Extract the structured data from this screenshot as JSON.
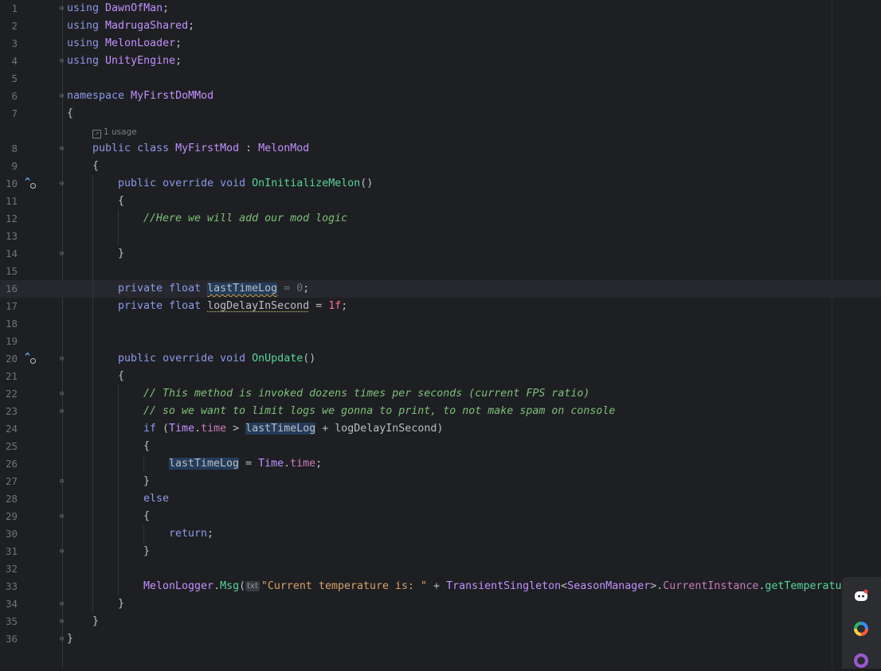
{
  "editor": {
    "line_numbers": [
      "1",
      "2",
      "3",
      "4",
      "5",
      "6",
      "7",
      "8",
      "9",
      "10",
      "11",
      "12",
      "13",
      "14",
      "15",
      "16",
      "17",
      "18",
      "19",
      "20",
      "21",
      "22",
      "23",
      "24",
      "25",
      "26",
      "27",
      "28",
      "29",
      "30",
      "31",
      "32",
      "33",
      "34",
      "35",
      "36"
    ],
    "usage_hint": "1 usage",
    "param_hint": "txt",
    "tokens": {
      "using": "using",
      "ns1": "DawnOfMan",
      "ns2": "MadrugaShared",
      "ns3": "MelonLoader",
      "ns4": "UnityEngine",
      "semicolon": ";",
      "namespace_kw": "namespace",
      "namespace_name": "MyFirstDoMMod",
      "open_brace": "{",
      "close_brace": "}",
      "public": "public",
      "class_kw": "class",
      "class_name": "MyFirstMod",
      "colon": " : ",
      "base_class": "MelonMod",
      "override": "override",
      "void": "void",
      "private": "private",
      "float": "float",
      "method1": "OnInitializeMelon",
      "method2": "OnUpdate",
      "parens": "()",
      "comment1": "//Here we will add our mod logic",
      "field1": "lastTimeLog",
      "assign": " = ",
      "zero": "0",
      "field2": "logDelayInSecond",
      "one_f": "1f",
      "comment2": "// This method is invoked dozens times per seconds (current FPS ratio)",
      "comment3": "// so we want to limit logs we gonna to print, to not make spam on console",
      "if_kw": "if",
      "else_kw": "else",
      "return_kw": "return",
      "time_cls": "Time",
      "time_prop": "time",
      "dot": ".",
      "gt": " > ",
      "plus": " + ",
      "open_paren": "(",
      "close_paren": ")",
      "logger": "MelonLogger",
      "msg": "Msg",
      "str": "\"Current temperature is: \"",
      "singleton": "TransientSingleton",
      "lt": "<",
      "gt2": ">",
      "season_mgr": "SeasonManager",
      "current_instance": "CurrentInstance",
      "get_temp": "getTemperatu"
    }
  },
  "colors": {
    "background": "#1e1f22",
    "keyword": "#cf8e6d",
    "type": "#c191ff",
    "method": "#57d49b",
    "string": "#d6a16a",
    "comment": "#7ec07a",
    "number": "#ff6f8a"
  },
  "side_panel": {
    "icons": [
      "discord-icon",
      "colorful-ring-icon",
      "purple-ring-icon"
    ]
  }
}
